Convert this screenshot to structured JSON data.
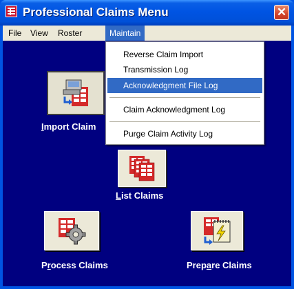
{
  "window": {
    "title": "Professional Claims Menu",
    "close_glyph": "✕",
    "app_icon": "claims-app-icon"
  },
  "menubar": {
    "items": [
      "File",
      "View",
      "Roster",
      "Maintain"
    ],
    "active": "Maintain"
  },
  "maintain_menu": {
    "items": [
      {
        "label": "Reverse Claim Import"
      },
      {
        "label": "Transmission Log"
      },
      {
        "label": "Acknowledgment File Log",
        "highlighted": true
      },
      {
        "separator": true
      },
      {
        "label": "Claim Acknowledgment Log"
      },
      {
        "separator": true
      },
      {
        "label": "Purge Claim Activity Log"
      }
    ]
  },
  "tiles": {
    "import": {
      "prefix": "",
      "hotkey": "I",
      "suffix": "mport Claim",
      "icon": "import-claims-icon"
    },
    "list": {
      "prefix": "",
      "hotkey": "L",
      "suffix": "ist Claims",
      "icon": "list-claims-icon"
    },
    "process": {
      "prefix": "P",
      "hotkey": "r",
      "suffix": "ocess Claims",
      "icon": "process-claims-icon"
    },
    "prepare": {
      "prefix": "Prep",
      "hotkey": "a",
      "suffix": "re Claims",
      "icon": "prepare-claims-icon"
    }
  },
  "colors": {
    "titlebar": "#0054e3",
    "client_background": "#000080",
    "menu_highlight": "#316ac5",
    "close_button": "#d4452b"
  }
}
